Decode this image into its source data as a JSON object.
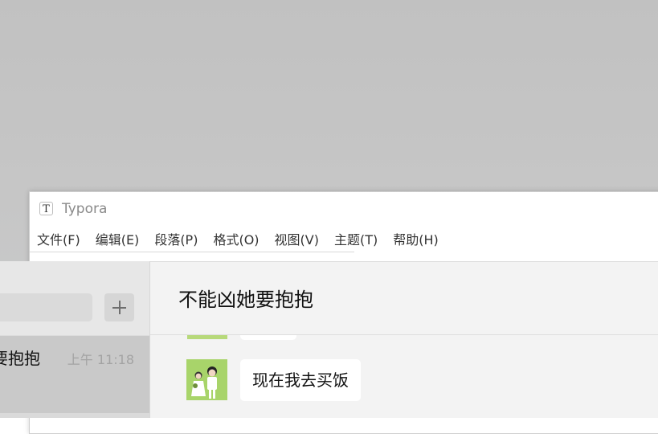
{
  "typora": {
    "logo_letter": "T",
    "title": "Typora",
    "menu": [
      "文件(F)",
      "编辑(E)",
      "段落(P)",
      "格式(O)",
      "视图(V)",
      "主题(T)",
      "帮助(H)"
    ]
  },
  "wechat": {
    "add_button_icon": "plus-icon",
    "chat_list": [
      {
        "name": "不能凶她要抱抱",
        "visible_name": "要抱抱",
        "time": "上午 11:18",
        "selected": true
      }
    ],
    "current_chat": {
      "title": "不能凶她要抱抱",
      "messages": [
        {
          "sender": "self",
          "text": "现在我去买饭"
        }
      ]
    }
  },
  "colors": {
    "desktop_bg": "#c4c4c4",
    "chat_list_bg": "#e7e7e7",
    "selected_item_bg": "#c9c9c9",
    "chat_bg": "#f3f3f3",
    "bubble_bg": "#ffffff",
    "avatar_green": "#a8d46a"
  }
}
